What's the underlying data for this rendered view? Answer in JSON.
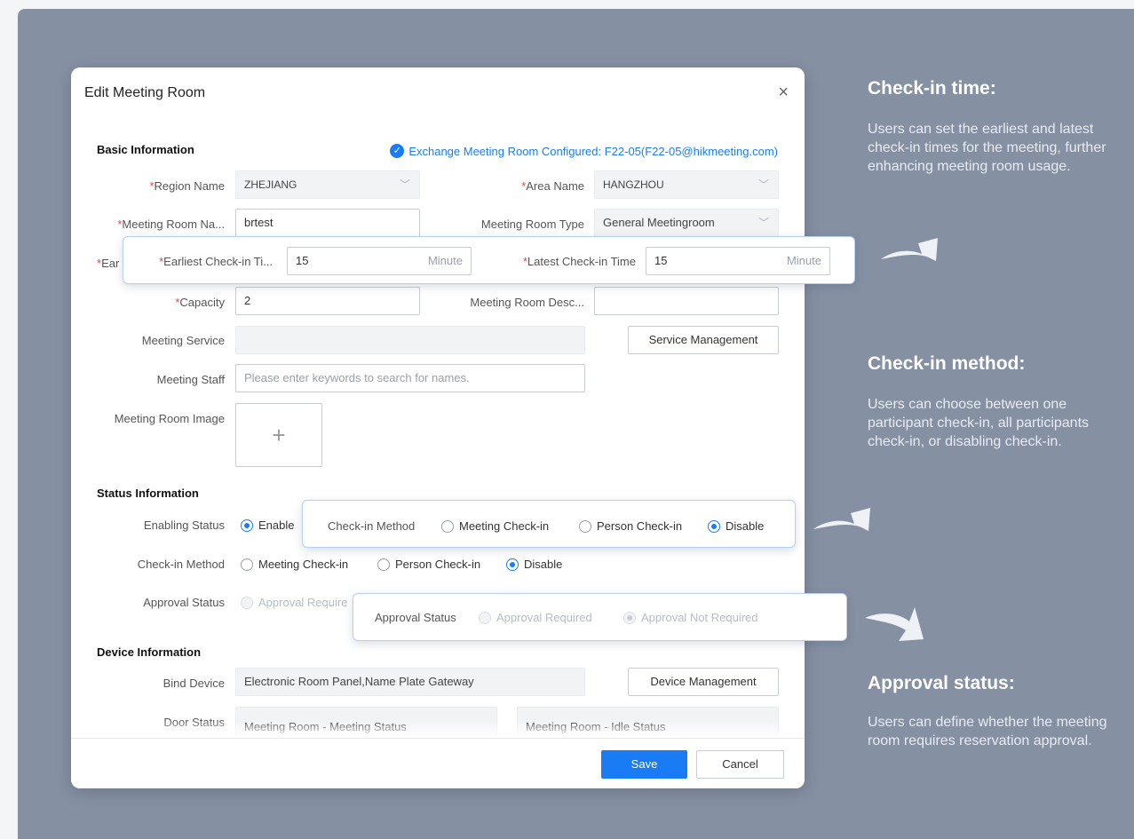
{
  "dialog": {
    "title": "Edit Meeting Room",
    "close": "×",
    "exchange_note": "Exchange Meeting Room Configured: F22-05(F22-05@hikmeeting.com)",
    "required_mark": "*",
    "basic": {
      "heading": "Basic Information",
      "region_label": "Region Name",
      "region_value": "ZHEJIANG",
      "area_label": "Area Name",
      "area_value": "HANGZHOU",
      "room_name_label": "Meeting Room Na...",
      "room_name_value": "brtest",
      "room_type_label": "Meeting Room Type",
      "room_type_value": "General Meetingroom",
      "earliest_label_truncated": "Ear",
      "capacity_label": "Capacity",
      "capacity_value": "2",
      "desc_label": "Meeting Room Desc...",
      "desc_value": "",
      "service_label": "Meeting Service",
      "service_button": "Service Management",
      "staff_label": "Meeting Staff",
      "staff_placeholder": "Please enter keywords to search for names.",
      "image_label": "Meeting Room Image",
      "image_add": "+"
    },
    "status": {
      "heading": "Status Information",
      "enabling_label": "Enabling Status",
      "enable_option": "Enable",
      "checkin_label": "Check-in Method",
      "checkin_options": [
        "Meeting Check-in",
        "Person Check-in",
        "Disable"
      ],
      "approval_label": "Approval Status",
      "approval_option_truncated": "Approval Require"
    },
    "device": {
      "heading": "Device Information",
      "bind_label": "Bind Device",
      "bind_value": "Electronic Room Panel,Name Plate Gateway",
      "device_button": "Device Management",
      "door_label": "Door Status",
      "door_left": "Meeting Room - Meeting Status",
      "door_right": "Meeting Room - Idle Status"
    },
    "footer": {
      "save": "Save",
      "cancel": "Cancel"
    }
  },
  "callouts": {
    "checkin_time": {
      "earliest_label": "Earliest Check-in Ti...",
      "earliest_value": "15",
      "latest_label": "Latest Check-in Time",
      "latest_value": "15",
      "unit": "Minute"
    },
    "checkin_method": {
      "label": "Check-in Method",
      "options": [
        "Meeting Check-in",
        "Person Check-in",
        "Disable"
      ]
    },
    "approval": {
      "label": "Approval Status",
      "options": [
        "Approval Required",
        "Approval Not Required"
      ]
    }
  },
  "side": {
    "checkin_time_title": "Check-in time:",
    "checkin_time_text": "Users can set the earliest and latest check-in times for the meeting, further enhancing meeting room usage.",
    "checkin_method_title": "Check-in method:",
    "checkin_method_text": "Users can choose between one participant check-in, all participants check-in, or disabling check-in.",
    "approval_title": "Approval status:",
    "approval_text": "Users can define whether the meeting room requires reservation approval."
  },
  "colors": {
    "backdrop": "#8590a3",
    "accent": "#1a7cf5",
    "required": "#e64340"
  }
}
